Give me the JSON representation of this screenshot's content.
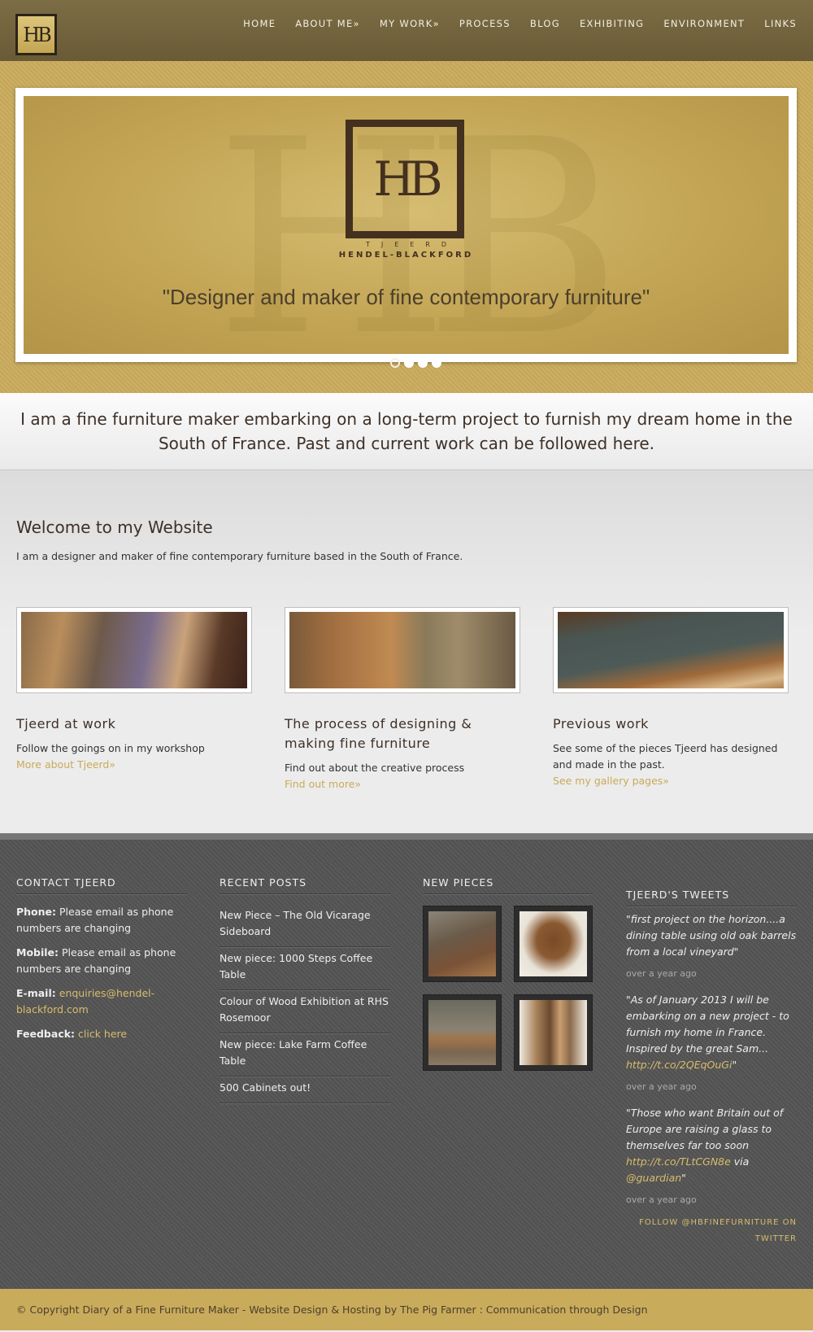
{
  "header": {
    "logo_text": "HB",
    "nav": [
      {
        "label": "HOME"
      },
      {
        "label": "ABOUT ME»"
      },
      {
        "label": "MY WORK»"
      },
      {
        "label": "PROCESS"
      },
      {
        "label": "BLOG"
      },
      {
        "label": "EXHIBITING"
      },
      {
        "label": "ENVIRONMENT"
      },
      {
        "label": "LINKS"
      }
    ]
  },
  "slider": {
    "logo_text": "HB",
    "sub1": "TJEERD",
    "sub2": "HENDEL-BLACKFORD",
    "tagline": "\"Designer and maker of fine contemporary furniture\"",
    "active_slide": 1,
    "slide_count": 4
  },
  "intro": {
    "text": "I am a fine furniture maker embarking on a long-term project to furnish my dream home in the South of France. Past and current work can be followed here."
  },
  "welcome": {
    "title": "Welcome to my Website",
    "text": "I am a designer and maker of fine contemporary furniture based in the South of France."
  },
  "features": [
    {
      "title": "Tjeerd at work",
      "text": "Follow the goings on in my workshop",
      "link": "More about Tjeerd»"
    },
    {
      "title": "The process of designing & making fine furniture",
      "text": "Find out about the creative process",
      "link": "Find out more»"
    },
    {
      "title": "Previous work",
      "text": "See some of the pieces Tjeerd has designed and made in the past.",
      "link": "See my gallery pages»"
    }
  ],
  "footer": {
    "contact": {
      "title": "CONTACT TJEERD",
      "phone_label": "Phone:",
      "phone": "Please email as phone numbers are changing",
      "mobile_label": "Mobile:",
      "mobile": "Please email as phone numbers are changing",
      "email_label": "E-mail:",
      "email": "enquiries@hendel-blackford.com",
      "feedback_label": "Feedback:",
      "feedback": "click here"
    },
    "recent_posts": {
      "title": "RECENT POSTS",
      "items": [
        "New Piece – The Old Vicarage Sideboard",
        "New piece: 1000 Steps Coffee Table",
        "Colour of Wood Exhibition at RHS Rosemoor",
        "New piece: Lake Farm Coffee Table",
        "500 Cabinets out!"
      ]
    },
    "new_pieces": {
      "title": "NEW PIECES"
    },
    "tweets": {
      "title": "TJEERD'S TWEETS",
      "items": [
        {
          "pre": "\"first project on the horizon....a dining table using old oak barrels from a local vineyard\"",
          "link": "",
          "mid": "",
          "link2": "",
          "post": "",
          "time": "over a year ago"
        },
        {
          "pre": "\"As of January 2013 I will be embarking on a new project - to furnish my home in France. Inspired by the great Sam... ",
          "link": "http://t.co/2QEqOuGi",
          "mid": "",
          "link2": "",
          "post": "\"",
          "time": "over a year ago"
        },
        {
          "pre": "\"Those who want Britain out of Europe are raising a glass to themselves far too soon ",
          "link": "http://t.co/TLtCGN8e",
          "mid": " via ",
          "link2": "@guardian",
          "post": "\"",
          "time": "over a year ago"
        }
      ],
      "follow": "FOLLOW @HBFINEFURNITURE ON TWITTER"
    }
  },
  "copyright": "© Copyright Diary of a Fine Furniture Maker - Website Design & Hosting by The Pig Farmer : Communication through Design"
}
